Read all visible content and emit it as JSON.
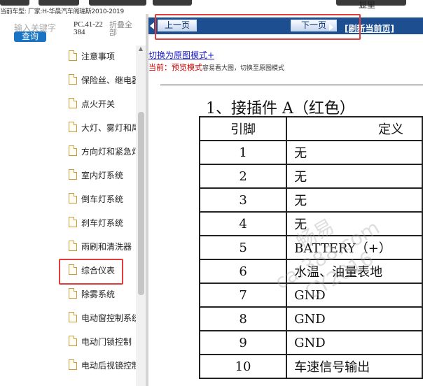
{
  "top_bar": {
    "vehicle_line": "当前车型:  厂家:H-华晨汽车阁瑞斯2010-2019",
    "right_label": "显里"
  },
  "left_panel": {
    "search_label": "输入关键字",
    "query_button": "查询",
    "pc_code": "PC.41-22384",
    "fold_all": "折叠全部",
    "tree_items": [
      "注意事项",
      "保险丝、继电器",
      "点火开关",
      "大灯、雾灯和尾灯",
      "方向灯和紧急灯",
      "室内灯系统",
      "倒车灯系统",
      "刹车灯系统",
      "雨刷和清洗器",
      "综合仪表",
      "除雾系统",
      "电动窗控制系统",
      "电动门锁控制",
      "电动后视镜控制"
    ],
    "selected_item": "综合仪表"
  },
  "right_panel": {
    "prev_page": "上一页",
    "next_page": "下一页",
    "refresh": "[刷新当前页]",
    "mode_switch": "切换为原图模式+",
    "current_label": "当前：",
    "current_mode": "预览模式",
    "mode_hint": "容易看大图，切换至原图模式",
    "doc_title": "1、接插件 A（红色）",
    "table": {
      "headers": [
        "引脚",
        "定义"
      ],
      "rows": [
        [
          "1",
          "无"
        ],
        [
          "2",
          "无"
        ],
        [
          "3",
          "无"
        ],
        [
          "4",
          "无"
        ],
        [
          "5",
          "BATTERY（+）"
        ],
        [
          "6",
          "水温、油量表地"
        ],
        [
          "7",
          "GND"
        ],
        [
          "8",
          "GND"
        ],
        [
          "9",
          "GND"
        ],
        [
          "10",
          "车速信号输出"
        ]
      ]
    },
    "watermark": [
      "畅易",
      "car388.com",
      "CY2016"
    ]
  },
  "colors": {
    "nav_bar": "#1d4e8f",
    "highlight": "#e23b3b",
    "query_button": "#1a74c4"
  }
}
